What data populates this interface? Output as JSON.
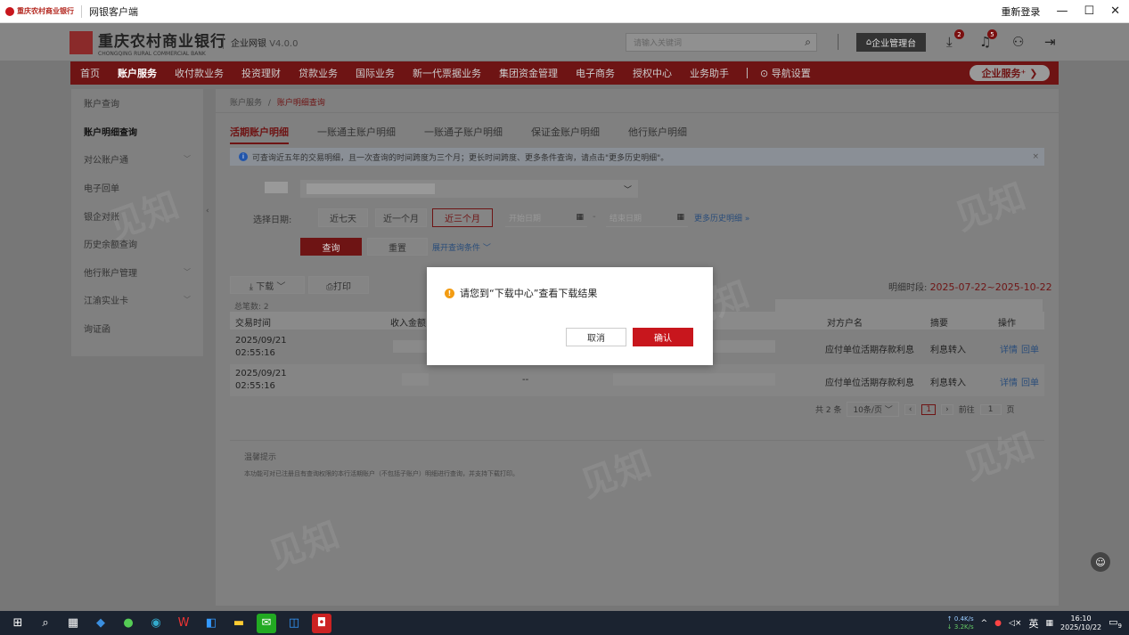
{
  "titlebar": {
    "logo_text": "重庆农村商业银行",
    "app_title": "网银客户端",
    "relogin": "重新登录",
    "minimize": "—",
    "maximize": "☐",
    "close": "✕"
  },
  "header": {
    "bank_name": "重庆农村商业银行",
    "bank_name_en": "CHONGQING RURAL COMMERCIAL BANK",
    "product": "企业网银",
    "version": "V4.0.0",
    "search_placeholder": "请输入关键词",
    "mgmt_label": "企业管理台",
    "download_badge": "2",
    "bell_badge": "5"
  },
  "nav": {
    "items": [
      "首页",
      "账户服务",
      "收付款业务",
      "投资理财",
      "贷款业务",
      "国际业务",
      "新一代票据业务",
      "集团资金管理",
      "电子商务",
      "授权中心",
      "业务助手"
    ],
    "active_index": 1,
    "nav_settings": "⊙ 导航设置",
    "enterprise_service": "企业服务⁺ ❯"
  },
  "sidebar": {
    "items": [
      {
        "label": "账户查询",
        "chevron": ""
      },
      {
        "label": "账户明细查询",
        "chevron": ""
      },
      {
        "label": "对公账户通",
        "chevron": "﹀"
      },
      {
        "label": "电子回单",
        "chevron": ""
      },
      {
        "label": "银企对账",
        "chevron": ""
      },
      {
        "label": "历史余额查询",
        "chevron": ""
      },
      {
        "label": "他行账户管理",
        "chevron": "﹀"
      },
      {
        "label": "江渝实业卡",
        "chevron": "﹀"
      },
      {
        "label": "询证函",
        "chevron": ""
      }
    ],
    "active_index": 1
  },
  "breadcrumb": {
    "root": "账户服务",
    "sep": "/",
    "current": "账户明细查询"
  },
  "tabs": [
    "活期账户明细",
    "一账通主账户明细",
    "一账通子账户明细",
    "保证金账户明细",
    "他行账户明细"
  ],
  "notice": {
    "text": "可查询近五年的交易明细，且一次查询的时间跨度为三个月；更长时间跨度、更多条件查询，请点击\"更多历史明细\"。",
    "close": "×"
  },
  "date_filter": {
    "label": "选择日期:",
    "options": [
      "近七天",
      "近一个月",
      "近三个月"
    ],
    "selected_index": 2,
    "start_placeholder": "开始日期",
    "end_placeholder": "结束日期",
    "dash": "-",
    "more_history": "更多历史明细 »"
  },
  "actions": {
    "query": "查询",
    "reset": "重置",
    "expand": "展开查询条件 ﹀"
  },
  "toolbar": {
    "download": "⤓ 下载 ﹀",
    "print": "⎙打印",
    "period_label": "明细时段:",
    "period_value": "2025-07-22~2025-10-22"
  },
  "table": {
    "total": "总笔数: 2",
    "columns": [
      "交易时间",
      "收入金额",
      "对方户名",
      "摘要",
      "操作"
    ],
    "rows": [
      {
        "time": "2025/09/21 02:55:16",
        "income": "",
        "counterparty": "应付单位活期存款利息",
        "summary": "利息转入",
        "detail": "详情",
        "receipt": "回单",
        "dash": ""
      },
      {
        "time": "2025/09/21 02:55:16",
        "income": "",
        "counterparty": "应付单位活期存款利息",
        "summary": "利息转入",
        "detail": "详情",
        "receipt": "回单",
        "dash": "--"
      }
    ]
  },
  "pagination": {
    "total": "共 2 条",
    "page_size": "10条/页 ﹀",
    "prev": "‹",
    "page": "1",
    "next": "›",
    "goto": "前往",
    "goto_value": "1",
    "page_unit": "页"
  },
  "tips": {
    "title": "温馨提示",
    "text": "本功能可对已注册且有查询权限的本行活期账户（不包括子账户）明细进行查询，并支持下载打印。"
  },
  "modal": {
    "message": "请您到“下载中心”查看下载结果",
    "cancel": "取消",
    "confirm": "确认"
  },
  "watermark": {
    "text": "见知"
  },
  "tray": {
    "up": "↑ 0.4K/s",
    "down": "↓ 3.2K/s",
    "lang": "英",
    "time": "16:10",
    "date": "2025/10/22",
    "notif_count": "9"
  }
}
